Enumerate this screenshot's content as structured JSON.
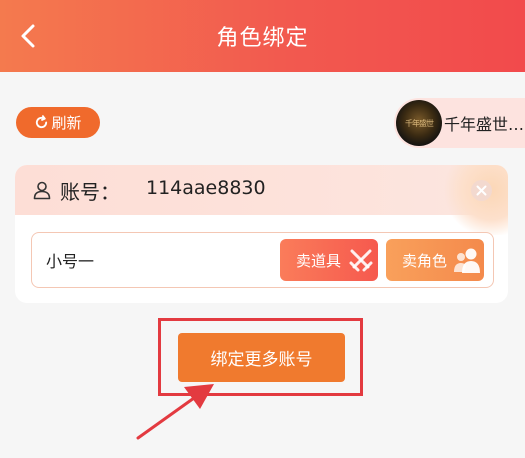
{
  "header": {
    "title": "角色绑定",
    "back_icon": "chevron-left-icon"
  },
  "toolbar": {
    "refresh_label": "刷新",
    "refresh_icon": "refresh-icon"
  },
  "server": {
    "name": "千年盛世…",
    "avatar_caption": "千年盛世"
  },
  "account_card": {
    "account_label": "账号：",
    "account_value": "114aae8830",
    "roles": [
      {
        "name": "小号一",
        "sell_item_label": "卖道具",
        "sell_role_label": "卖角色"
      }
    ]
  },
  "bind_more_label": "绑定更多账号",
  "colors": {
    "header_start": "#f47a4e",
    "header_end": "#f24a4c",
    "accent": "#f07a2e",
    "annotation": "#e33a40"
  }
}
